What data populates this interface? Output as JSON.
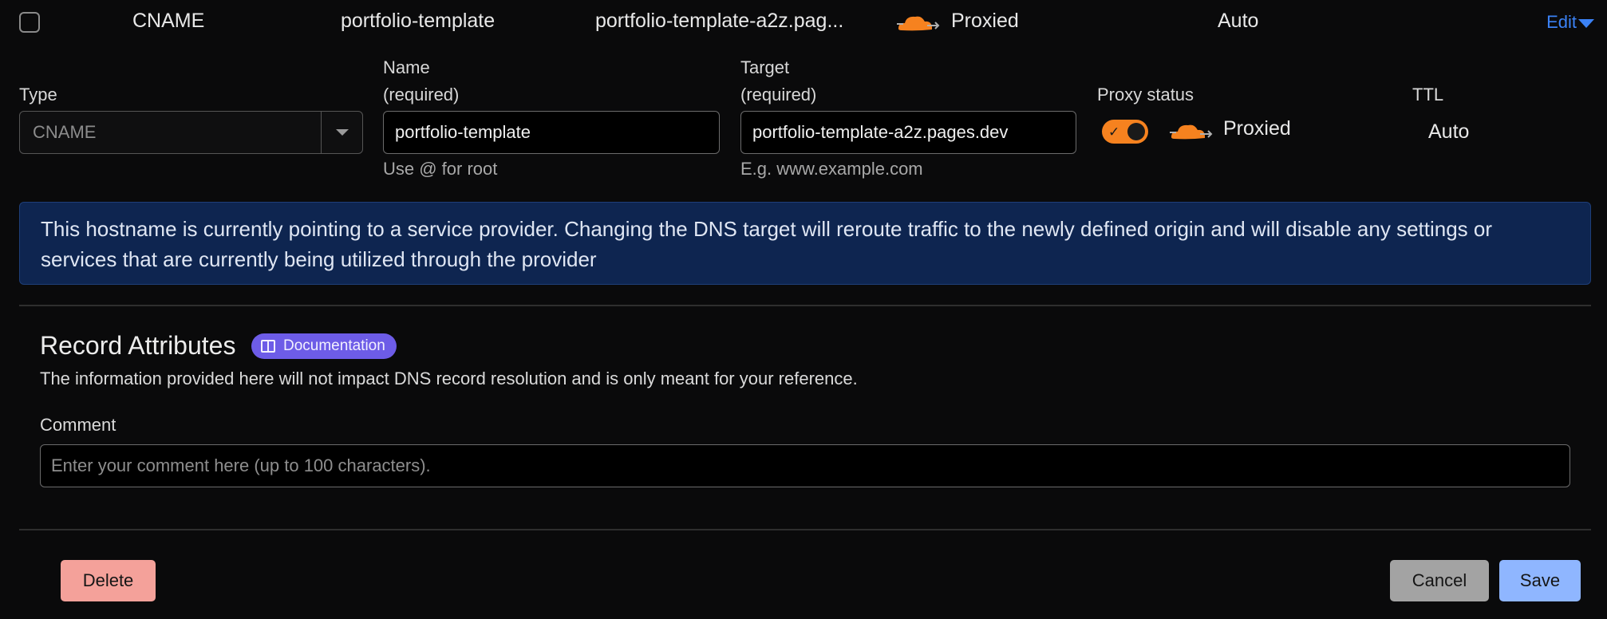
{
  "summary_row": {
    "type": "CNAME",
    "name": "portfolio-template",
    "target": "portfolio-template-a2z.pag...",
    "proxy_status": "Proxied",
    "ttl": "Auto",
    "edit_label": "Edit"
  },
  "form": {
    "type_label": "Type",
    "type_value": "CNAME",
    "name_label": "Name",
    "name_required": "(required)",
    "name_value": "portfolio-template",
    "name_hint": "Use @ for root",
    "target_label": "Target",
    "target_required": "(required)",
    "target_value": "portfolio-template-a2z.pages.dev",
    "target_hint": "E.g. www.example.com",
    "proxy_label": "Proxy status",
    "proxy_value": "Proxied",
    "ttl_label": "TTL",
    "ttl_value": "Auto"
  },
  "banner": {
    "text": "This hostname is currently pointing to a service provider. Changing the DNS target will reroute traffic to the newly defined origin and will disable any settings or services that are currently being utilized through the provider"
  },
  "attributes": {
    "title": "Record Attributes",
    "doc_badge": "Documentation",
    "description": "The information provided here will not impact DNS record resolution and is only meant for your reference.",
    "comment_label": "Comment",
    "comment_placeholder": "Enter your comment here (up to 100 characters)."
  },
  "actions": {
    "delete": "Delete",
    "cancel": "Cancel",
    "save": "Save"
  },
  "colors": {
    "accent": "#3b82f6",
    "cloud": "#f6821f",
    "banner_bg": "#0e2550",
    "badge": "#6d5ce7",
    "delete": "#f4a19a",
    "save": "#8fb6ff"
  },
  "icons": {
    "proxy": "cloud-proxied-icon",
    "doc": "book-icon",
    "edit": "caret-down-icon",
    "toggle": "check-icon"
  }
}
